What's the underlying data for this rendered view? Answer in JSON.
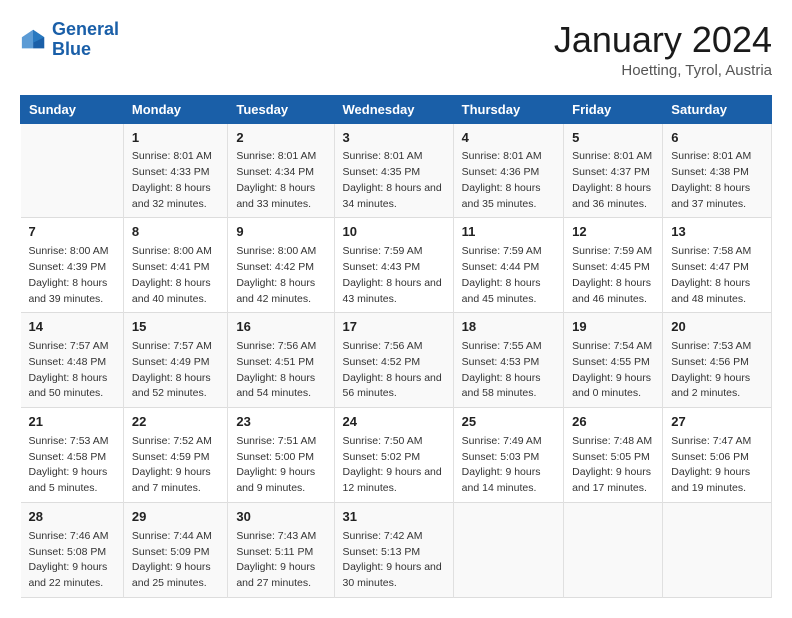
{
  "header": {
    "logo_line1": "General",
    "logo_line2": "Blue",
    "title": "January 2024",
    "subtitle": "Hoetting, Tyrol, Austria"
  },
  "days_of_week": [
    "Sunday",
    "Monday",
    "Tuesday",
    "Wednesday",
    "Thursday",
    "Friday",
    "Saturday"
  ],
  "weeks": [
    [
      {
        "day": "",
        "sunrise": "",
        "sunset": "",
        "daylight": ""
      },
      {
        "day": "1",
        "sunrise": "Sunrise: 8:01 AM",
        "sunset": "Sunset: 4:33 PM",
        "daylight": "Daylight: 8 hours and 32 minutes."
      },
      {
        "day": "2",
        "sunrise": "Sunrise: 8:01 AM",
        "sunset": "Sunset: 4:34 PM",
        "daylight": "Daylight: 8 hours and 33 minutes."
      },
      {
        "day": "3",
        "sunrise": "Sunrise: 8:01 AM",
        "sunset": "Sunset: 4:35 PM",
        "daylight": "Daylight: 8 hours and 34 minutes."
      },
      {
        "day": "4",
        "sunrise": "Sunrise: 8:01 AM",
        "sunset": "Sunset: 4:36 PM",
        "daylight": "Daylight: 8 hours and 35 minutes."
      },
      {
        "day": "5",
        "sunrise": "Sunrise: 8:01 AM",
        "sunset": "Sunset: 4:37 PM",
        "daylight": "Daylight: 8 hours and 36 minutes."
      },
      {
        "day": "6",
        "sunrise": "Sunrise: 8:01 AM",
        "sunset": "Sunset: 4:38 PM",
        "daylight": "Daylight: 8 hours and 37 minutes."
      }
    ],
    [
      {
        "day": "7",
        "sunrise": "Sunrise: 8:00 AM",
        "sunset": "Sunset: 4:39 PM",
        "daylight": "Daylight: 8 hours and 39 minutes."
      },
      {
        "day": "8",
        "sunrise": "Sunrise: 8:00 AM",
        "sunset": "Sunset: 4:41 PM",
        "daylight": "Daylight: 8 hours and 40 minutes."
      },
      {
        "day": "9",
        "sunrise": "Sunrise: 8:00 AM",
        "sunset": "Sunset: 4:42 PM",
        "daylight": "Daylight: 8 hours and 42 minutes."
      },
      {
        "day": "10",
        "sunrise": "Sunrise: 7:59 AM",
        "sunset": "Sunset: 4:43 PM",
        "daylight": "Daylight: 8 hours and 43 minutes."
      },
      {
        "day": "11",
        "sunrise": "Sunrise: 7:59 AM",
        "sunset": "Sunset: 4:44 PM",
        "daylight": "Daylight: 8 hours and 45 minutes."
      },
      {
        "day": "12",
        "sunrise": "Sunrise: 7:59 AM",
        "sunset": "Sunset: 4:45 PM",
        "daylight": "Daylight: 8 hours and 46 minutes."
      },
      {
        "day": "13",
        "sunrise": "Sunrise: 7:58 AM",
        "sunset": "Sunset: 4:47 PM",
        "daylight": "Daylight: 8 hours and 48 minutes."
      }
    ],
    [
      {
        "day": "14",
        "sunrise": "Sunrise: 7:57 AM",
        "sunset": "Sunset: 4:48 PM",
        "daylight": "Daylight: 8 hours and 50 minutes."
      },
      {
        "day": "15",
        "sunrise": "Sunrise: 7:57 AM",
        "sunset": "Sunset: 4:49 PM",
        "daylight": "Daylight: 8 hours and 52 minutes."
      },
      {
        "day": "16",
        "sunrise": "Sunrise: 7:56 AM",
        "sunset": "Sunset: 4:51 PM",
        "daylight": "Daylight: 8 hours and 54 minutes."
      },
      {
        "day": "17",
        "sunrise": "Sunrise: 7:56 AM",
        "sunset": "Sunset: 4:52 PM",
        "daylight": "Daylight: 8 hours and 56 minutes."
      },
      {
        "day": "18",
        "sunrise": "Sunrise: 7:55 AM",
        "sunset": "Sunset: 4:53 PM",
        "daylight": "Daylight: 8 hours and 58 minutes."
      },
      {
        "day": "19",
        "sunrise": "Sunrise: 7:54 AM",
        "sunset": "Sunset: 4:55 PM",
        "daylight": "Daylight: 9 hours and 0 minutes."
      },
      {
        "day": "20",
        "sunrise": "Sunrise: 7:53 AM",
        "sunset": "Sunset: 4:56 PM",
        "daylight": "Daylight: 9 hours and 2 minutes."
      }
    ],
    [
      {
        "day": "21",
        "sunrise": "Sunrise: 7:53 AM",
        "sunset": "Sunset: 4:58 PM",
        "daylight": "Daylight: 9 hours and 5 minutes."
      },
      {
        "day": "22",
        "sunrise": "Sunrise: 7:52 AM",
        "sunset": "Sunset: 4:59 PM",
        "daylight": "Daylight: 9 hours and 7 minutes."
      },
      {
        "day": "23",
        "sunrise": "Sunrise: 7:51 AM",
        "sunset": "Sunset: 5:00 PM",
        "daylight": "Daylight: 9 hours and 9 minutes."
      },
      {
        "day": "24",
        "sunrise": "Sunrise: 7:50 AM",
        "sunset": "Sunset: 5:02 PM",
        "daylight": "Daylight: 9 hours and 12 minutes."
      },
      {
        "day": "25",
        "sunrise": "Sunrise: 7:49 AM",
        "sunset": "Sunset: 5:03 PM",
        "daylight": "Daylight: 9 hours and 14 minutes."
      },
      {
        "day": "26",
        "sunrise": "Sunrise: 7:48 AM",
        "sunset": "Sunset: 5:05 PM",
        "daylight": "Daylight: 9 hours and 17 minutes."
      },
      {
        "day": "27",
        "sunrise": "Sunrise: 7:47 AM",
        "sunset": "Sunset: 5:06 PM",
        "daylight": "Daylight: 9 hours and 19 minutes."
      }
    ],
    [
      {
        "day": "28",
        "sunrise": "Sunrise: 7:46 AM",
        "sunset": "Sunset: 5:08 PM",
        "daylight": "Daylight: 9 hours and 22 minutes."
      },
      {
        "day": "29",
        "sunrise": "Sunrise: 7:44 AM",
        "sunset": "Sunset: 5:09 PM",
        "daylight": "Daylight: 9 hours and 25 minutes."
      },
      {
        "day": "30",
        "sunrise": "Sunrise: 7:43 AM",
        "sunset": "Sunset: 5:11 PM",
        "daylight": "Daylight: 9 hours and 27 minutes."
      },
      {
        "day": "31",
        "sunrise": "Sunrise: 7:42 AM",
        "sunset": "Sunset: 5:13 PM",
        "daylight": "Daylight: 9 hours and 30 minutes."
      },
      {
        "day": "",
        "sunrise": "",
        "sunset": "",
        "daylight": ""
      },
      {
        "day": "",
        "sunrise": "",
        "sunset": "",
        "daylight": ""
      },
      {
        "day": "",
        "sunrise": "",
        "sunset": "",
        "daylight": ""
      }
    ]
  ]
}
